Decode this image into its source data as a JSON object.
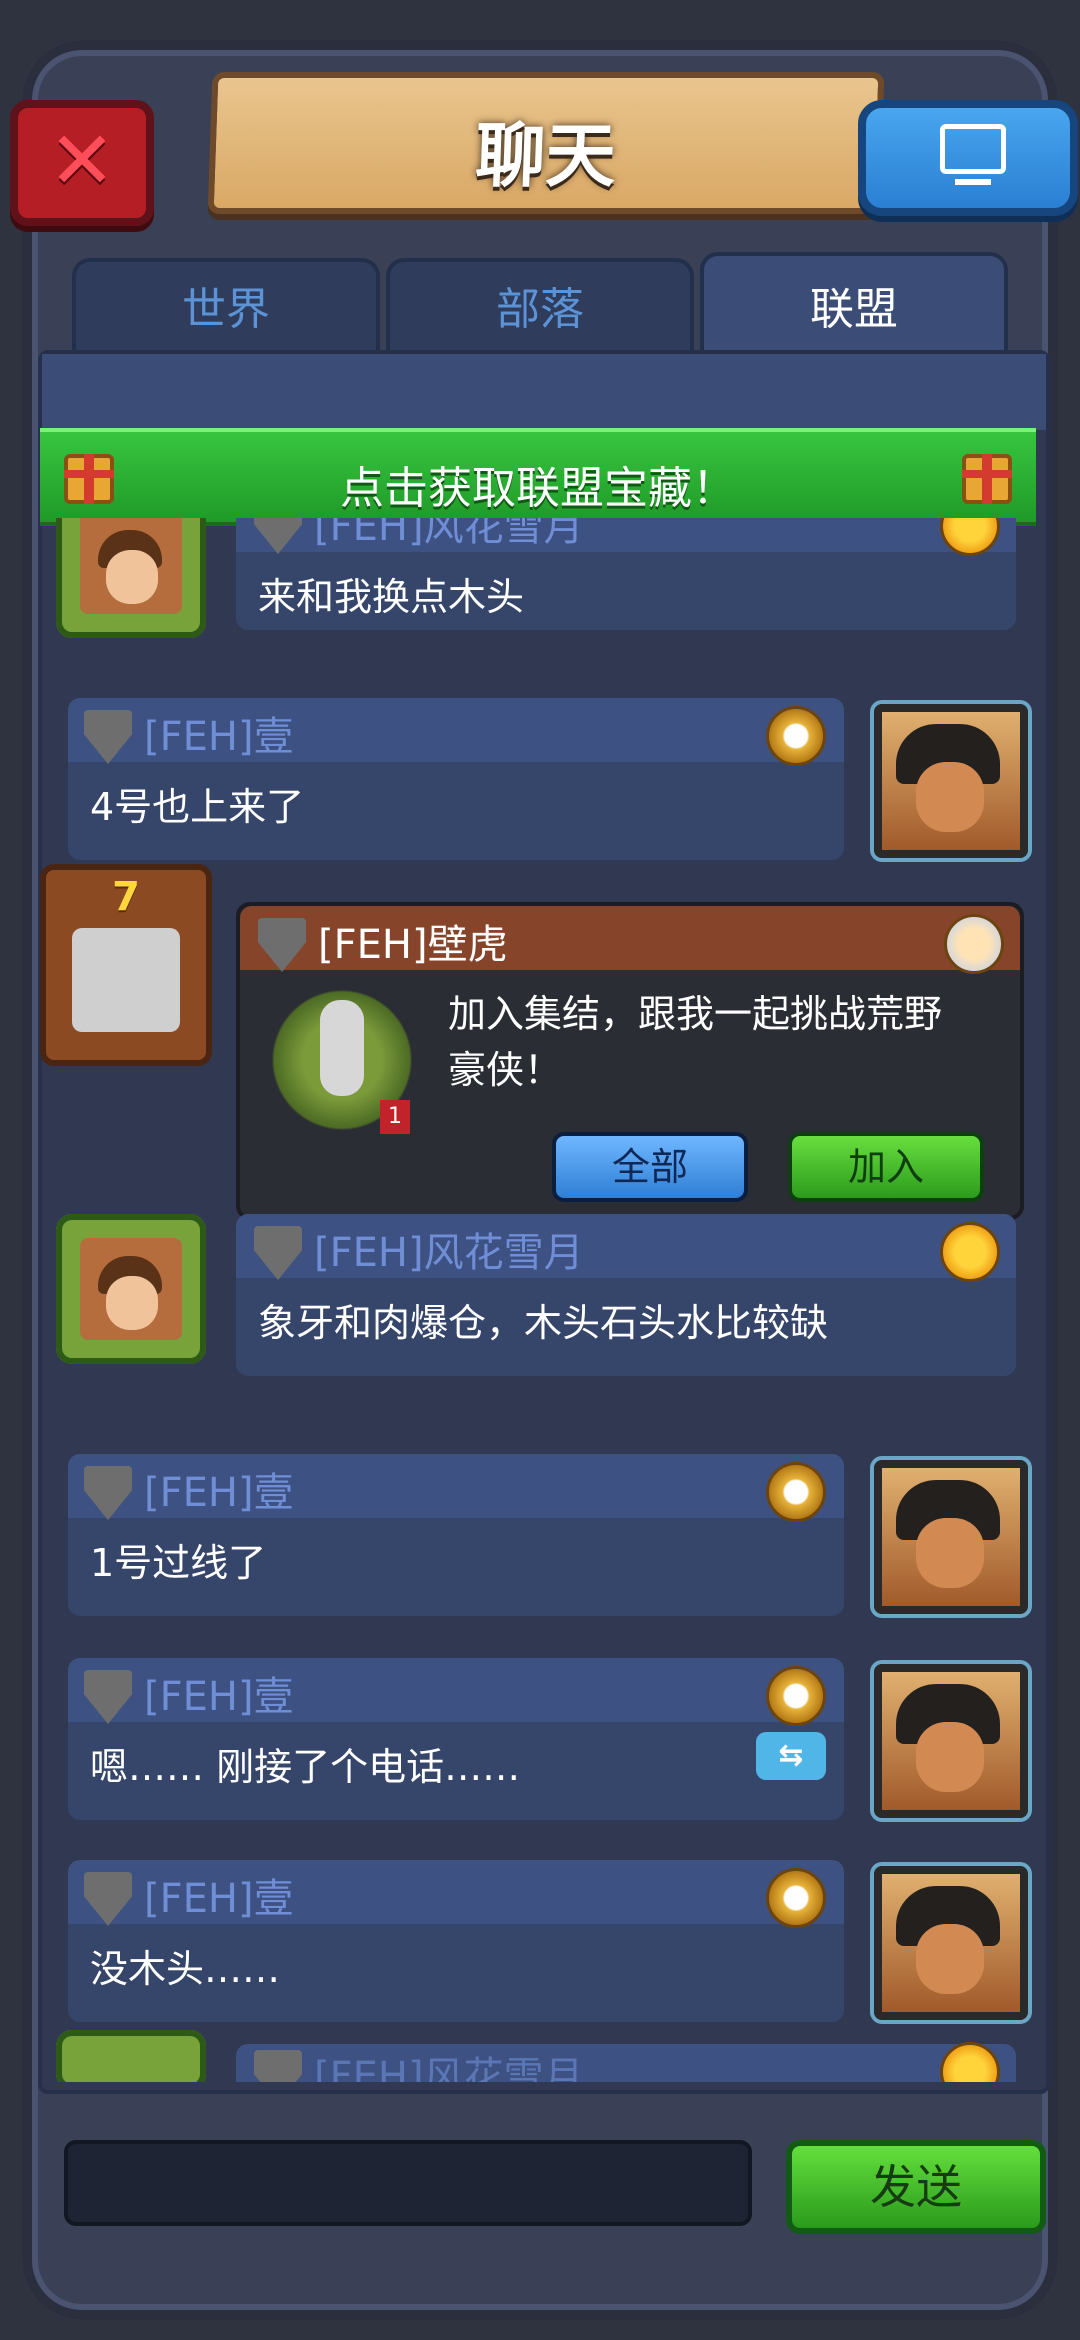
{
  "header": {
    "title": "聊天",
    "close_icon": "close-icon",
    "screen_icon": "monitor-icon"
  },
  "tabs": [
    {
      "label": "世界",
      "active": false
    },
    {
      "label": "部落",
      "active": false
    },
    {
      "label": "联盟",
      "active": true
    }
  ],
  "banner": {
    "text": "点击获取联盟宝藏！"
  },
  "messages": [
    {
      "id": "m1",
      "name": "[FEH]风花雪月",
      "text": "来和我换点木头",
      "side": "left"
    },
    {
      "id": "m2",
      "name": "[FEH]壹",
      "text": "4号也上来了",
      "side": "right"
    },
    {
      "id": "m3",
      "type": "rally",
      "name": "[FEH]壁虎",
      "level": "7",
      "hero_level": "1",
      "text": "加入集结，跟我一起挑战荒野豪侠！",
      "buttons": {
        "all": "全部",
        "join": "加入"
      }
    },
    {
      "id": "m4",
      "name": "[FEH]风花雪月",
      "text": "象牙和肉爆仓，木头石头水比较缺",
      "side": "left"
    },
    {
      "id": "m5",
      "name": "[FEH]壹",
      "text": "1号过线了",
      "side": "right"
    },
    {
      "id": "m6",
      "name": "[FEH]壹",
      "text": "嗯…… 刚接了个电话……",
      "side": "right"
    },
    {
      "id": "m7",
      "name": "[FEH]壹",
      "text": "没木头……",
      "side": "right"
    },
    {
      "id": "m8",
      "name": "[FEH]风花雪月",
      "text": "",
      "side": "left"
    }
  ],
  "composer": {
    "placeholder": "",
    "send_label": "发送"
  },
  "colors": {
    "tab_active": "#3b4d76",
    "banner_green": "#29a82f",
    "send_green": "#3fbf2a",
    "name_blue": "#6f8ed6"
  }
}
